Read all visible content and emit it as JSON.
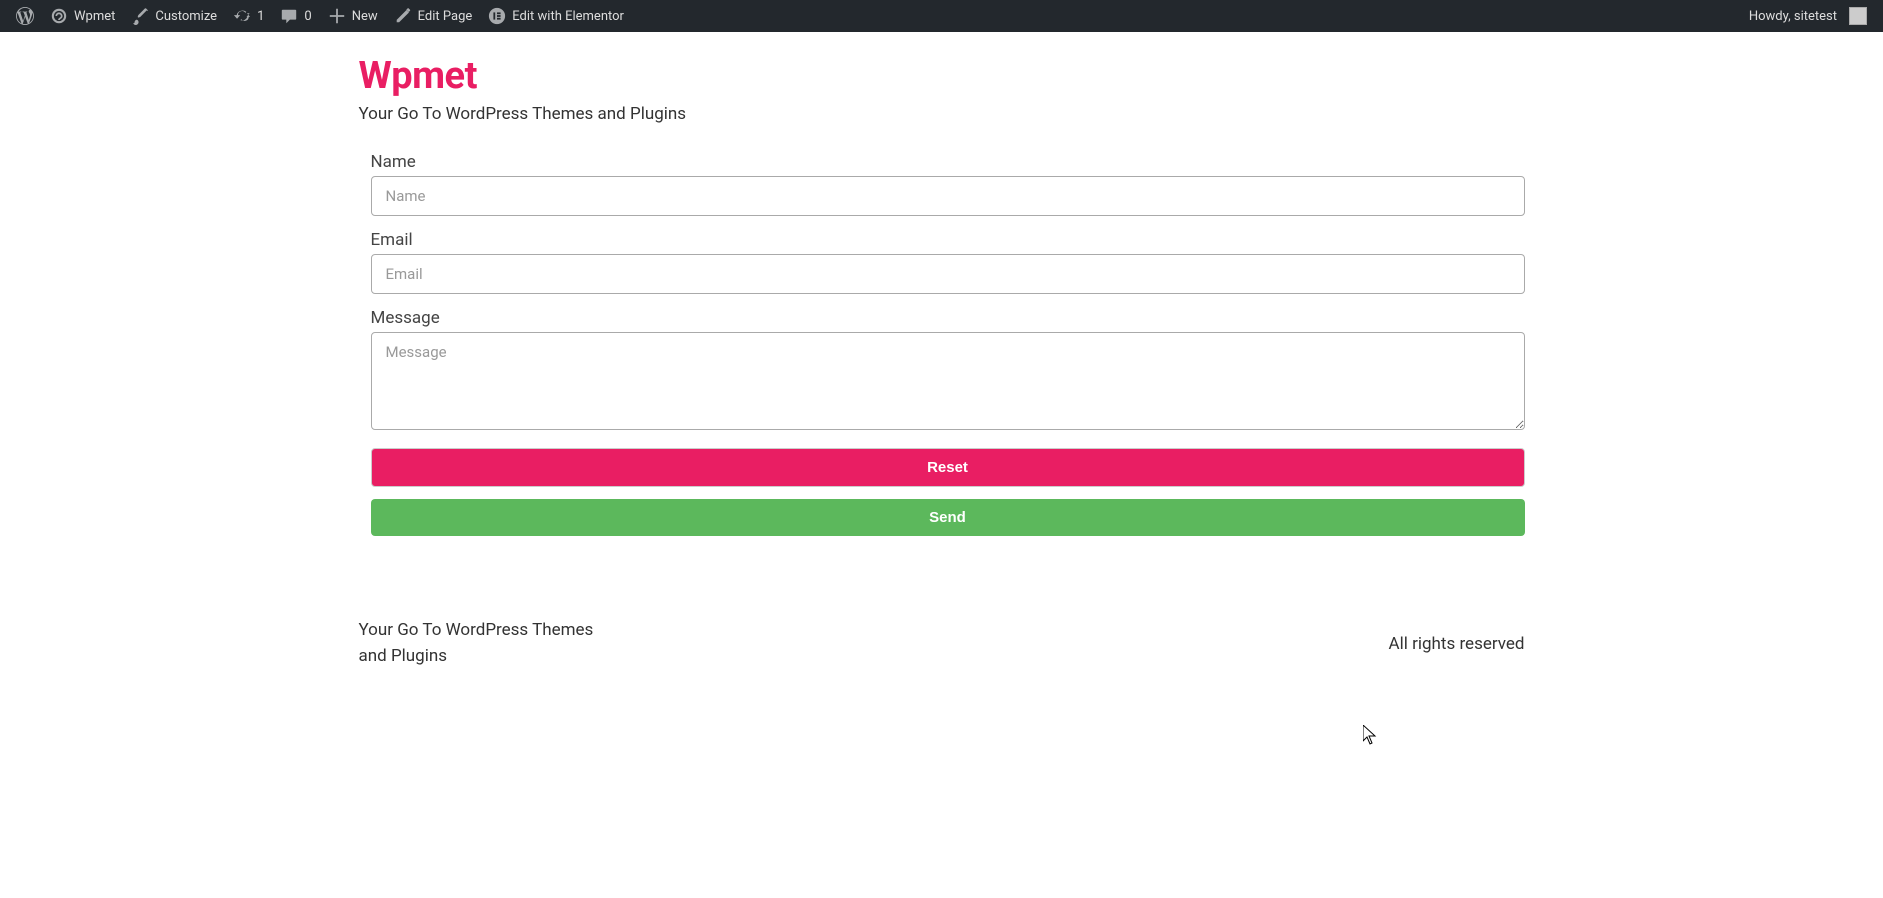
{
  "admin_bar": {
    "site_name": "Wpmet",
    "customize": "Customize",
    "updates_count": "1",
    "comments_count": "0",
    "new": "New",
    "edit_page": "Edit Page",
    "edit_with_elementor": "Edit with Elementor",
    "howdy": "Howdy, sitetest"
  },
  "header": {
    "title": "Wpmet",
    "tagline": "Your Go To WordPress Themes and Plugins"
  },
  "form": {
    "name_label": "Name",
    "name_placeholder": "Name",
    "email_label": "Email",
    "email_placeholder": "Email",
    "message_label": "Message",
    "message_placeholder": "Message",
    "reset_label": "Reset",
    "send_label": "Send"
  },
  "footer": {
    "left_text": "Your Go To WordPress Themes and Plugins",
    "right_text": "All rights reserved"
  }
}
